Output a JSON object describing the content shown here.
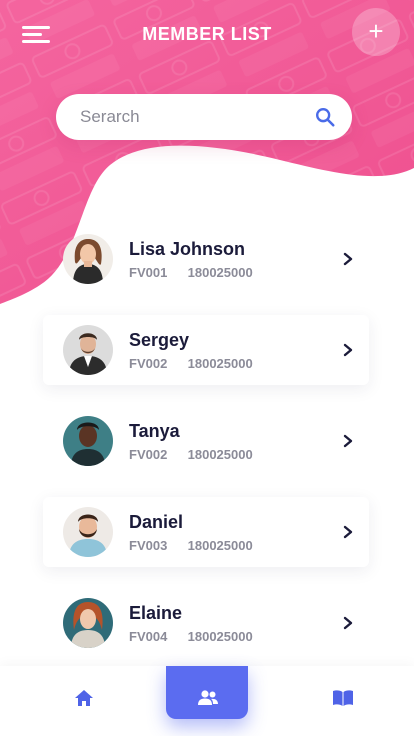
{
  "header": {
    "title": "MEMBER LIST",
    "add_label": "+"
  },
  "search": {
    "placeholder": "Serarch",
    "value": ""
  },
  "members": [
    {
      "name": "Lisa Johnson",
      "code": "FV001",
      "number": "180025000"
    },
    {
      "name": "Sergey",
      "code": "FV002",
      "number": "180025000"
    },
    {
      "name": "Tanya",
      "code": "FV002",
      "number": "180025000"
    },
    {
      "name": "Daniel",
      "code": "FV003",
      "number": "180025000"
    },
    {
      "name": "Elaine",
      "code": "FV004",
      "number": "180025000"
    }
  ],
  "bottom_nav": {
    "items": [
      {
        "icon": "home-icon",
        "active": false
      },
      {
        "icon": "people-icon",
        "active": true
      },
      {
        "icon": "book-icon",
        "active": false
      }
    ]
  },
  "colors": {
    "brand_pink": "#f25c98",
    "accent_blue": "#5b6cf0",
    "name_text": "#1b1b3a",
    "meta_text": "#8b8b98"
  }
}
